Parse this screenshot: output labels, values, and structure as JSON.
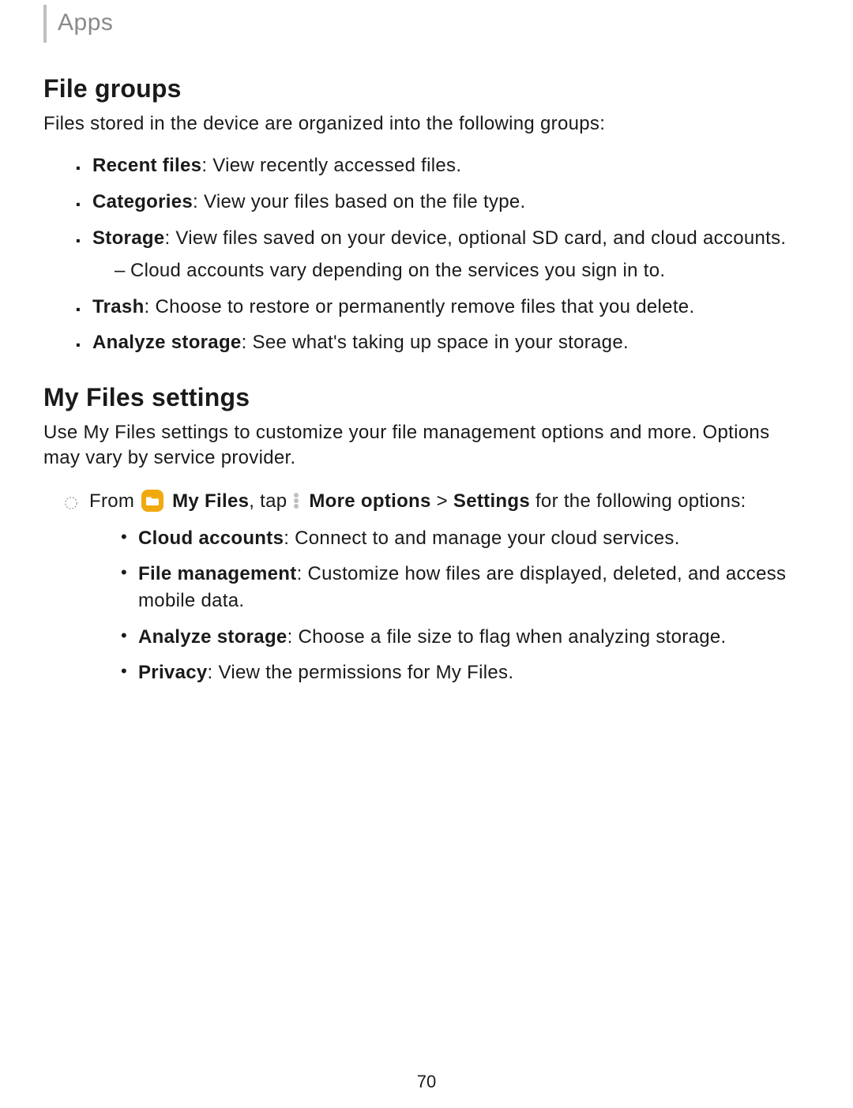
{
  "header": {
    "breadcrumb": "Apps"
  },
  "section1": {
    "title": "File groups",
    "intro": "Files stored in the device are organized into the following groups:",
    "items": [
      {
        "bold": "Recent files",
        "text": ": View recently accessed files."
      },
      {
        "bold": "Categories",
        "text": ": View your files based on the file type."
      },
      {
        "bold": "Storage",
        "text": ": View files saved on your device, optional SD card, and cloud accounts.",
        "sub": "Cloud accounts vary depending on the services you sign in to."
      },
      {
        "bold": "Trash",
        "text": ": Choose to restore or permanently remove files that you delete."
      },
      {
        "bold": "Analyze storage",
        "text": ": See what's taking up space in your storage."
      }
    ]
  },
  "section2": {
    "title": "My Files settings",
    "intro": "Use My Files settings to customize your file management options and more. Options may vary by service provider.",
    "step": {
      "pre": "From ",
      "app": "My Files",
      "mid": ", tap ",
      "more": "More options",
      "sep": " > ",
      "settings": "Settings",
      "post": " for the following options:"
    },
    "items": [
      {
        "bold": "Cloud accounts",
        "text": ": Connect to and manage your cloud services."
      },
      {
        "bold": "File management",
        "text": ": Customize how files are displayed, deleted, and access mobile data."
      },
      {
        "bold": "Analyze storage",
        "text": ": Choose a file size to flag when analyzing storage."
      },
      {
        "bold": "Privacy",
        "text": ": View the permissions for My Files."
      }
    ]
  },
  "pageNumber": "70"
}
